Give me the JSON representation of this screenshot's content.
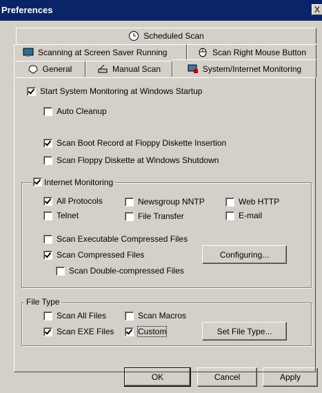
{
  "window": {
    "title": "Preferences",
    "close_glyph": "X"
  },
  "tabs": {
    "scheduled": "Scheduled Scan",
    "screensaver": "Scanning at Screen Saver Running",
    "right_mouse": "Scan Right Mouse Button",
    "general": "General",
    "manual": "Manual Scan",
    "system": "System/Internet Monitoring"
  },
  "options": {
    "start_monitoring": {
      "label": "Start System Monitoring at Windows Startup",
      "checked": true
    },
    "auto_cleanup": {
      "label": "Auto Cleanup",
      "checked": false
    },
    "scan_boot": {
      "label": "Scan Boot Record at Floppy Diskette Insertion",
      "checked": true
    },
    "scan_floppy_shutdown": {
      "label": "Scan Floppy Diskette at Windows Shutdown",
      "checked": false
    }
  },
  "internet": {
    "legend": "Internet Monitoring",
    "checked": true,
    "all_protocols": {
      "label": "All Protocols",
      "checked": true
    },
    "newsgroup": {
      "label": "Newsgroup NNTP",
      "checked": false
    },
    "web_http": {
      "label": "Web HTTP",
      "checked": false
    },
    "telnet": {
      "label": "Telnet",
      "checked": false
    },
    "file_transfer": {
      "label": "File Transfer",
      "checked": false
    },
    "email": {
      "label": "E-mail",
      "checked": false
    },
    "scan_exec_compressed": {
      "label": "Scan Executable Compressed Files",
      "checked": false
    },
    "scan_compressed": {
      "label": "Scan Compressed Files",
      "checked": true
    },
    "scan_double": {
      "label": "Scan Double-compressed Files",
      "checked": false
    },
    "configuring_button": "Configuring..."
  },
  "file_type": {
    "legend": "File Type",
    "scan_all": {
      "label": "Scan All Files",
      "checked": false
    },
    "scan_macros": {
      "label": "Scan Macros",
      "checked": false
    },
    "scan_exe": {
      "label": "Scan EXE Files",
      "checked": true
    },
    "custom": {
      "label": "Custom",
      "checked": true
    },
    "set_file_type_button": "Set File Type..."
  },
  "buttons": {
    "ok": "OK",
    "cancel": "Cancel",
    "apply": "Apply"
  }
}
